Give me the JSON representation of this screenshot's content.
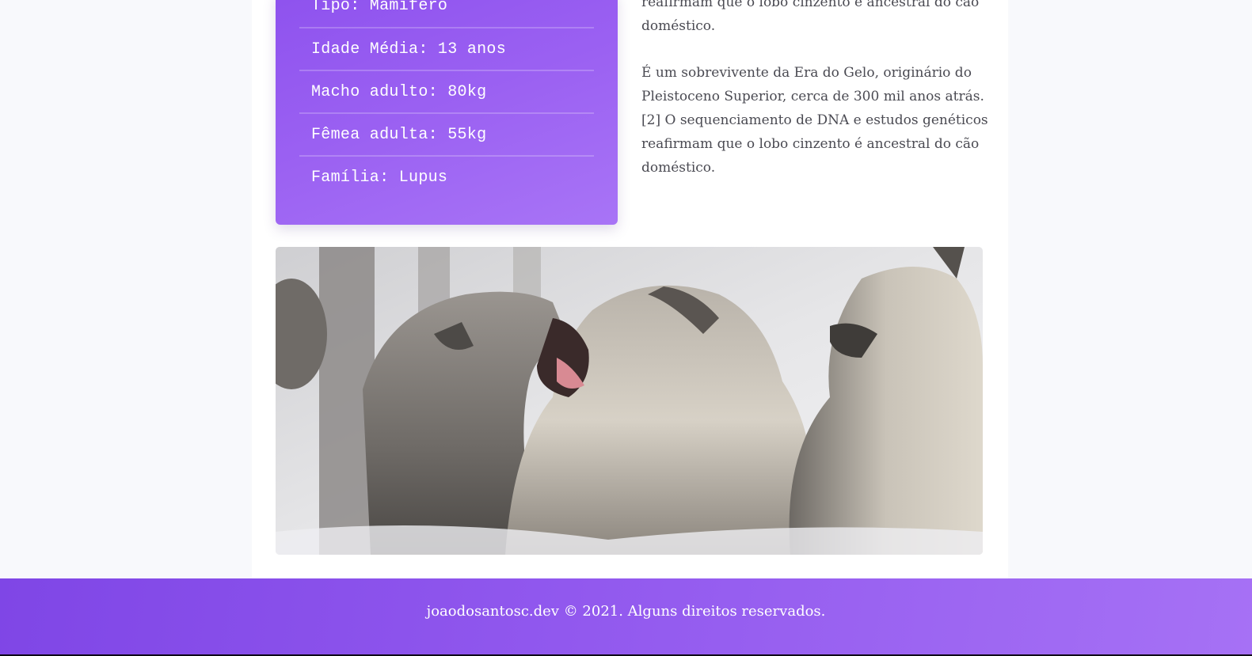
{
  "info_card": {
    "items": [
      "Tipo: Mamífero",
      "Idade Média: 13 anos",
      "Macho adulto: 80kg",
      "Fêmea adulta: 55kg",
      "Família: Lupus"
    ]
  },
  "article": {
    "paragraph_1": "reafirmam que o lobo cinzento é ancestral do cão doméstico.",
    "paragraph_2": "É um sobrevivente da Era do Gelo, originário do Pleistoceno Superior, cerca de 300 mil anos atrás.[2] O sequenciamento de DNA e estudos genéticos reafirmam que o lobo cinzento é ancestral do cão doméstico."
  },
  "photo": {
    "subject": "wolves-pack"
  },
  "footer": {
    "text": "joaodosantosc.dev © 2021. Alguns direitos reservados."
  },
  "colors": {
    "accent": "#9b61f2",
    "footer": "#8e52ee"
  }
}
